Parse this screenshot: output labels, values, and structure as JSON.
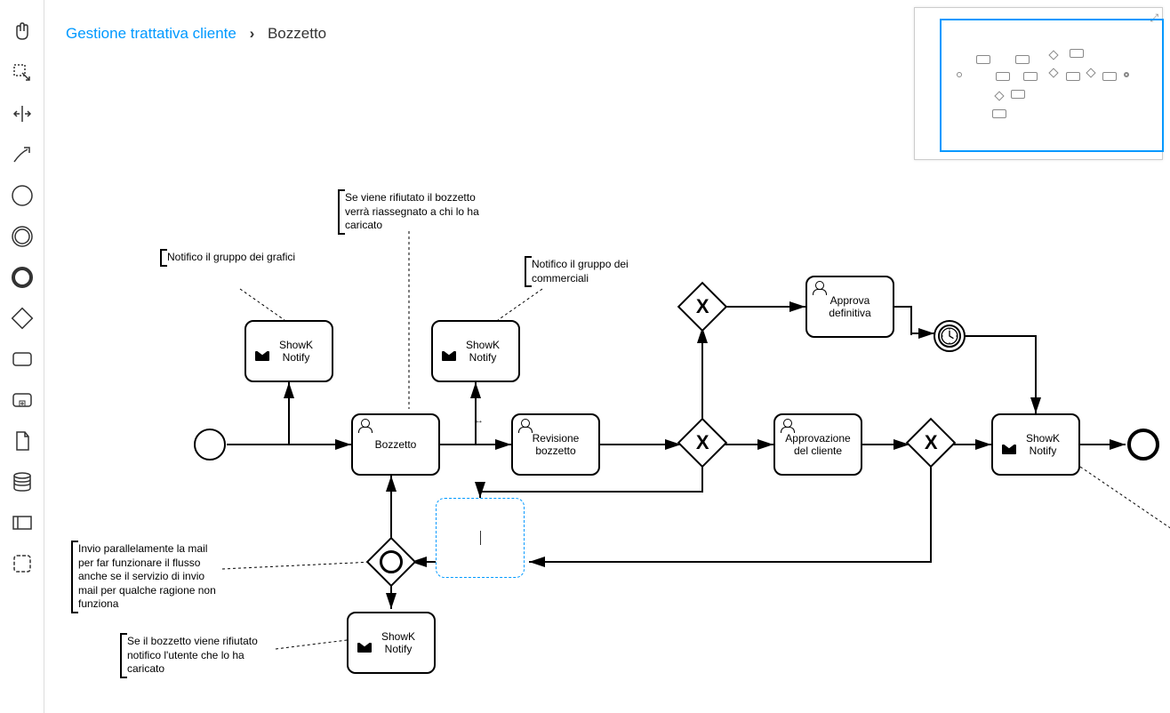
{
  "breadcrumb": {
    "parent": "Gestione trattativa cliente",
    "current": "Bozzetto"
  },
  "tasks": {
    "notify1": "ShowK Notify",
    "bozzetto": "Bozzetto",
    "notify2": "ShowK Notify",
    "revisione": "Revisione bozzetto",
    "approvazione": "Approvazione del cliente",
    "approva_def": "Approva definitiva",
    "notify3": "ShowK Notify",
    "notify4": "ShowK Notify",
    "editing": ""
  },
  "annotations": {
    "a1": "Notifico il gruppo dei grafici",
    "a2": "Se viene rifiutato il bozzetto verrà riassegnato a chi lo ha caricato",
    "a3": "Notifico il gruppo dei commerciali",
    "a4": "Invio parallelamente la mail per far funzionare il flusso anche se il servizio di invio mail per qualche ragione non funziona",
    "a5": "Se il bozzetto viene rifiutato notifico l'utente che lo ha caricato"
  },
  "toolbar": {
    "hand": "hand-tool",
    "lasso": "lasso-tool",
    "space": "space-tool",
    "connect": "connect-tool",
    "start_event": "start-event",
    "intermediate_event": "intermediate-event",
    "end_event": "end-event",
    "gateway": "gateway",
    "task": "task",
    "subprocess": "subprocess",
    "data_object": "data-object",
    "data_store": "data-store",
    "participant": "participant",
    "group": "group"
  }
}
